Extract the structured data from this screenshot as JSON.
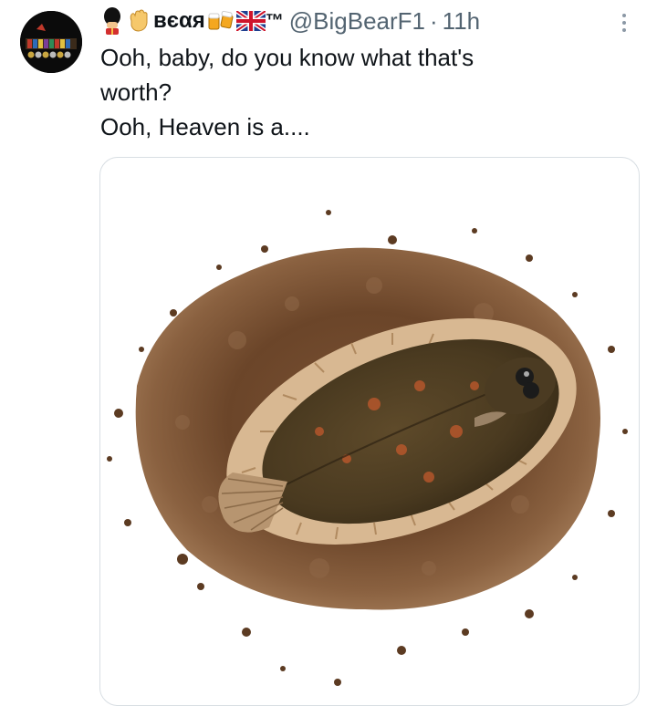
{
  "tweet": {
    "author_name": "ʙєαя",
    "trademark": "™",
    "handle": "@BigBearF1",
    "separator": "·",
    "time": "11h",
    "text_lines": [
      "Ooh, baby, do you know what that's",
      "worth?",
      "Ooh, Heaven is a...."
    ]
  },
  "icons": {
    "avatar": "avatar-medals",
    "guard": "royal-guard-emoji",
    "wave": "waving-hand-emoji",
    "beers": "clinking-beer-mugs-emoji",
    "flag": "union-jack-flag-emoji",
    "more": "more-options-icon"
  },
  "colors": {
    "text": "#0f1419",
    "secondary": "#536471",
    "border": "#d8dee3"
  }
}
